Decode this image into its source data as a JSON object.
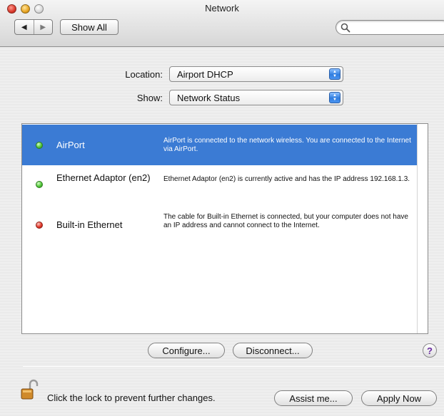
{
  "window": {
    "title": "Network"
  },
  "toolbar": {
    "back_glyph": "◀",
    "forward_glyph": "▶",
    "show_all": "Show All",
    "search_placeholder": ""
  },
  "location": {
    "label": "Location:",
    "value": "Airport DHCP"
  },
  "show": {
    "label": "Show:",
    "value": "Network Status"
  },
  "services": [
    {
      "name": "AirPort",
      "status": "green",
      "selected": true,
      "description": "AirPort is connected to the network wireless. You are connected to the Internet via AirPort."
    },
    {
      "name": "Ethernet Adaptor (en2)",
      "status": "green",
      "selected": false,
      "description": "Ethernet Adaptor (en2) is currently active and has the IP address 192.168.1.3."
    },
    {
      "name": "Built-in Ethernet",
      "status": "red",
      "selected": false,
      "description": "The cable for Built-in Ethernet is connected, but your computer does not have an IP address and cannot connect to the Internet."
    }
  ],
  "actions": {
    "configure": "Configure...",
    "disconnect": "Disconnect...",
    "help": "?"
  },
  "footer": {
    "lock_text": "Click the lock to prevent further changes.",
    "assist": "Assist me...",
    "apply": "Apply Now"
  },
  "colors": {
    "selection": "#3b7bd4",
    "status_green": "#53c83a",
    "status_red": "#e3382a"
  }
}
